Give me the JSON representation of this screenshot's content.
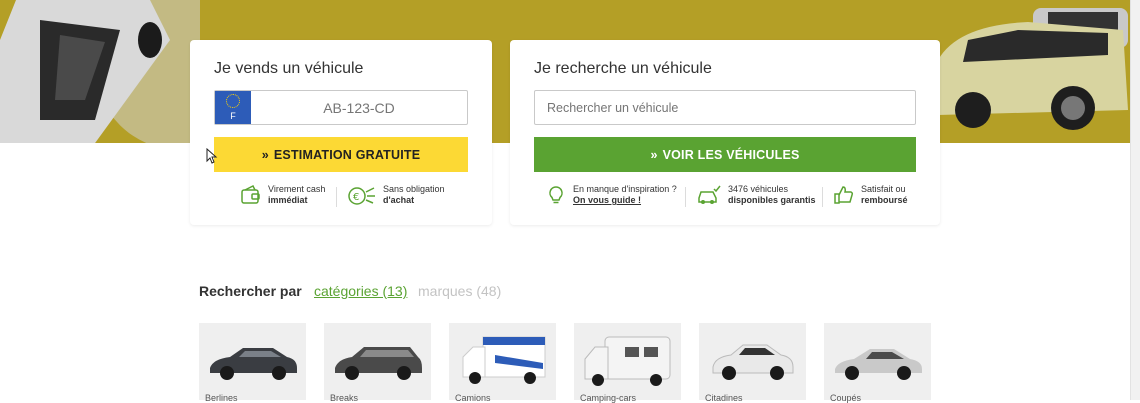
{
  "sell": {
    "title": "Je vends un véhicule",
    "plate_country": "F",
    "plate_placeholder": "AB-123-CD",
    "button": "ESTIMATION GRATUITE",
    "features": [
      {
        "line1": "Virement cash",
        "line2": "immédiat",
        "icon": "wallet-icon"
      },
      {
        "line1": "Sans obligation",
        "line2": "d'achat",
        "icon": "euro-coin-icon"
      }
    ]
  },
  "search": {
    "title": "Je recherche un véhicule",
    "placeholder": "Rechercher un véhicule",
    "button": "VOIR LES VÉHICULES",
    "features": [
      {
        "line1": "En manque d'inspiration ?",
        "line2": "On vous guide !",
        "icon": "lightbulb-icon"
      },
      {
        "line1": "3476 véhicules",
        "line2": "disponibles garantis",
        "icon": "car-check-icon"
      },
      {
        "line1": "Satisfait ou",
        "line2": "remboursé",
        "icon": "thumbs-up-icon"
      }
    ]
  },
  "browse": {
    "label": "Rechercher par",
    "tabs": [
      {
        "label": "catégories (13)",
        "active": true
      },
      {
        "label": "marques (48)",
        "active": false
      }
    ],
    "categories": [
      {
        "name": "Berline",
        "label": "Berlines",
        "color": "#3a3d42"
      },
      {
        "name": "Break",
        "label": "Breaks",
        "color": "#4a4a4a"
      },
      {
        "name": "Camion",
        "label": "Camions",
        "color": "#ffffff"
      },
      {
        "name": "Camping-car",
        "label": "Camping-cars",
        "color": "#f4f4f4"
      },
      {
        "name": "Citadine",
        "label": "Citadines",
        "color": "#e9e9e9"
      },
      {
        "name": "Coupé",
        "label": "Coupés",
        "color": "#c9c9c9"
      }
    ]
  },
  "colors": {
    "hero": "#b49f26",
    "accent_green": "#5aa332",
    "accent_yellow": "#fcd934"
  }
}
